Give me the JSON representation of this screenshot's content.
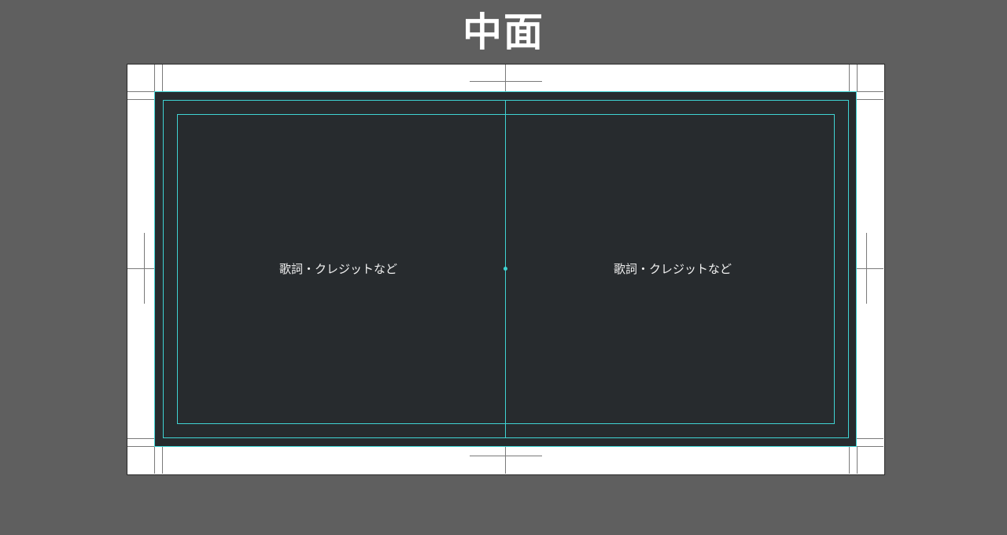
{
  "title": "中面",
  "panels": {
    "left_text": "歌詞・クレジットなど",
    "right_text": "歌詞・クレジットなど"
  },
  "colors": {
    "background": "#5f5f5f",
    "paper": "#ffffff",
    "print_area": "#272b2e",
    "guide": "#3fd3d3",
    "crop_mark": "#7a7a7a",
    "text": "#f0f0f0"
  }
}
